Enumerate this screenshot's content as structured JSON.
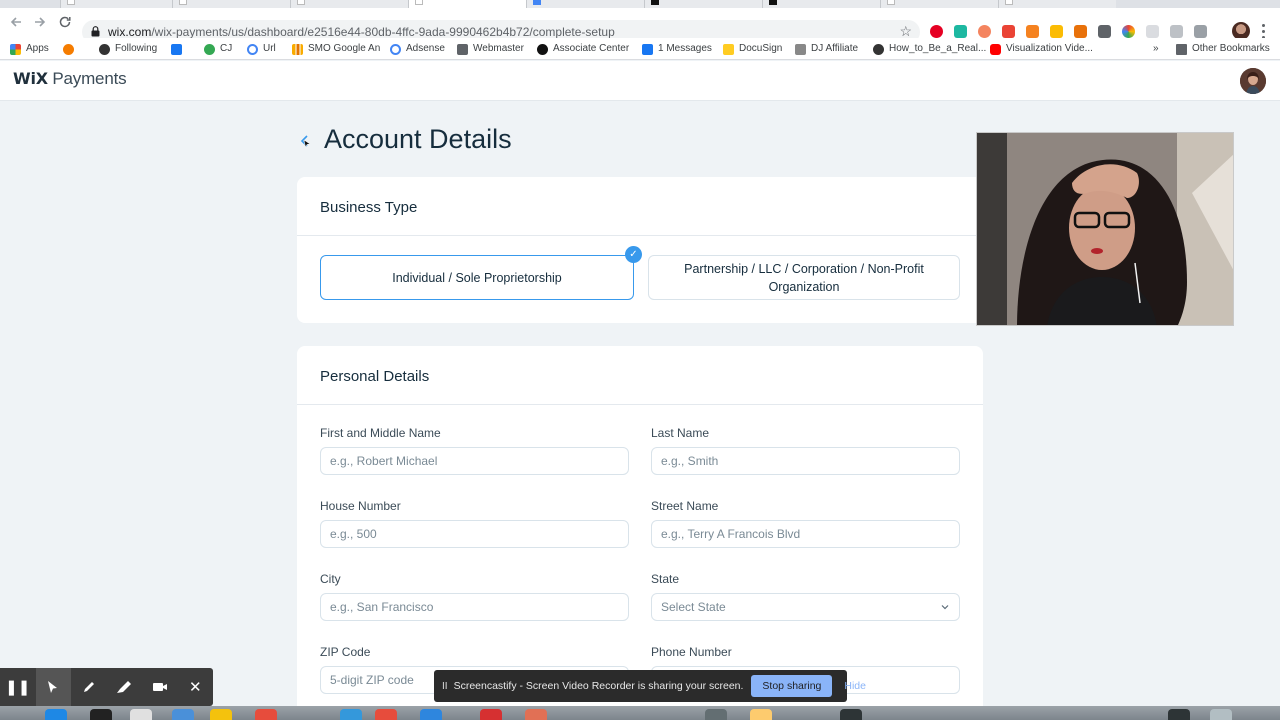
{
  "browser": {
    "url_host": "wix.com",
    "url_path": "/wix-payments/us/dashboard/e2516e44-80db-4ffc-9ada-9990462b4b72/complete-setup",
    "bookmarks": [
      {
        "label": "Apps",
        "icon": "apps-grid-icon",
        "color": "#e94235"
      },
      {
        "label": "",
        "icon": "orange-circle-icon",
        "color": "#f57c00"
      },
      {
        "label": "Following",
        "icon": "globe-icon",
        "color": "#333333"
      },
      {
        "label": "",
        "icon": "facebook-icon",
        "color": "#1877f2"
      },
      {
        "label": "CJ",
        "icon": "cj-icon",
        "color": "#34a853"
      },
      {
        "label": "Url",
        "icon": "google-icon",
        "color": "#4285f4"
      },
      {
        "label": "SMO Google An",
        "icon": "analytics-icon",
        "color": "#f9ab00"
      },
      {
        "label": "Adsense",
        "icon": "google-icon",
        "color": "#4285f4"
      },
      {
        "label": "Webmaster",
        "icon": "webmaster-icon",
        "color": "#5f6368"
      },
      {
        "label": "Associate Center",
        "icon": "amazon-icon",
        "color": "#111111"
      },
      {
        "label": "1 Messages",
        "icon": "facebook-icon",
        "color": "#1877f2"
      },
      {
        "label": "DocuSign",
        "icon": "docusign-icon",
        "color": "#ffcc22"
      },
      {
        "label": "DJ Affiliate",
        "icon": "dj-icon",
        "color": "#888888"
      },
      {
        "label": "How_to_Be_a_Real...",
        "icon": "globe-icon",
        "color": "#333333"
      },
      {
        "label": "Visualization Vide...",
        "icon": "youtube-icon",
        "color": "#ff0000"
      }
    ],
    "overflow_label": "»",
    "other_bookmarks_label": "Other Bookmarks"
  },
  "header": {
    "logo_wix": "WiX",
    "logo_product": "Payments"
  },
  "page": {
    "title": "Account Details"
  },
  "business_type": {
    "title": "Business Type",
    "options": [
      {
        "label": "Individual / Sole Proprietorship",
        "selected": true
      },
      {
        "label": "Partnership / LLC / Corporation / Non-Profit Organization",
        "selected": false
      }
    ]
  },
  "personal_details": {
    "title": "Personal Details",
    "fields": {
      "first_middle_name": {
        "label": "First and Middle Name",
        "placeholder": "e.g., Robert Michael"
      },
      "last_name": {
        "label": "Last Name",
        "placeholder": "e.g., Smith"
      },
      "house_number": {
        "label": "House Number",
        "placeholder": "e.g., 500"
      },
      "street_name": {
        "label": "Street Name",
        "placeholder": "e.g., Terry A Francois Blvd"
      },
      "city": {
        "label": "City",
        "placeholder": "e.g., San Francisco"
      },
      "state": {
        "label": "State",
        "value": "Select State"
      },
      "zip": {
        "label": "ZIP Code",
        "placeholder": "5-digit ZIP code"
      },
      "phone": {
        "label": "Phone Number",
        "placeholder": ""
      }
    }
  },
  "screencastify": {
    "message": "Screencastify - Screen Video Recorder is sharing your screen.",
    "stop_label": "Stop sharing",
    "hide_label": "Hide",
    "pause_glyph": "II"
  },
  "colors": {
    "accent": "#3899ec",
    "page_bg": "#eff3f6",
    "text_primary": "#162d3d"
  }
}
